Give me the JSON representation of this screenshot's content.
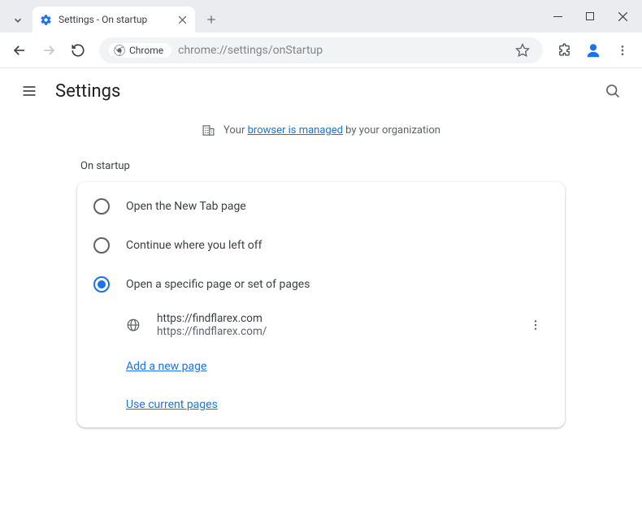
{
  "titlebar": {
    "tab_title": "Settings - On startup"
  },
  "toolbar": {
    "chip_label": "Chrome",
    "url": "chrome://settings/onStartup"
  },
  "header": {
    "title": "Settings"
  },
  "managed": {
    "prefix": "Your ",
    "link": "browser is managed",
    "suffix": " by your organization"
  },
  "section": {
    "title": "On startup"
  },
  "options": {
    "newtab": "Open the New Tab page",
    "continue": "Continue where you left off",
    "specific": "Open a specific page or set of pages"
  },
  "page": {
    "name": "https://findflarex.com",
    "url": "https://findflarex.com/"
  },
  "actions": {
    "add_page": "Add a new page",
    "use_current": "Use current pages"
  }
}
